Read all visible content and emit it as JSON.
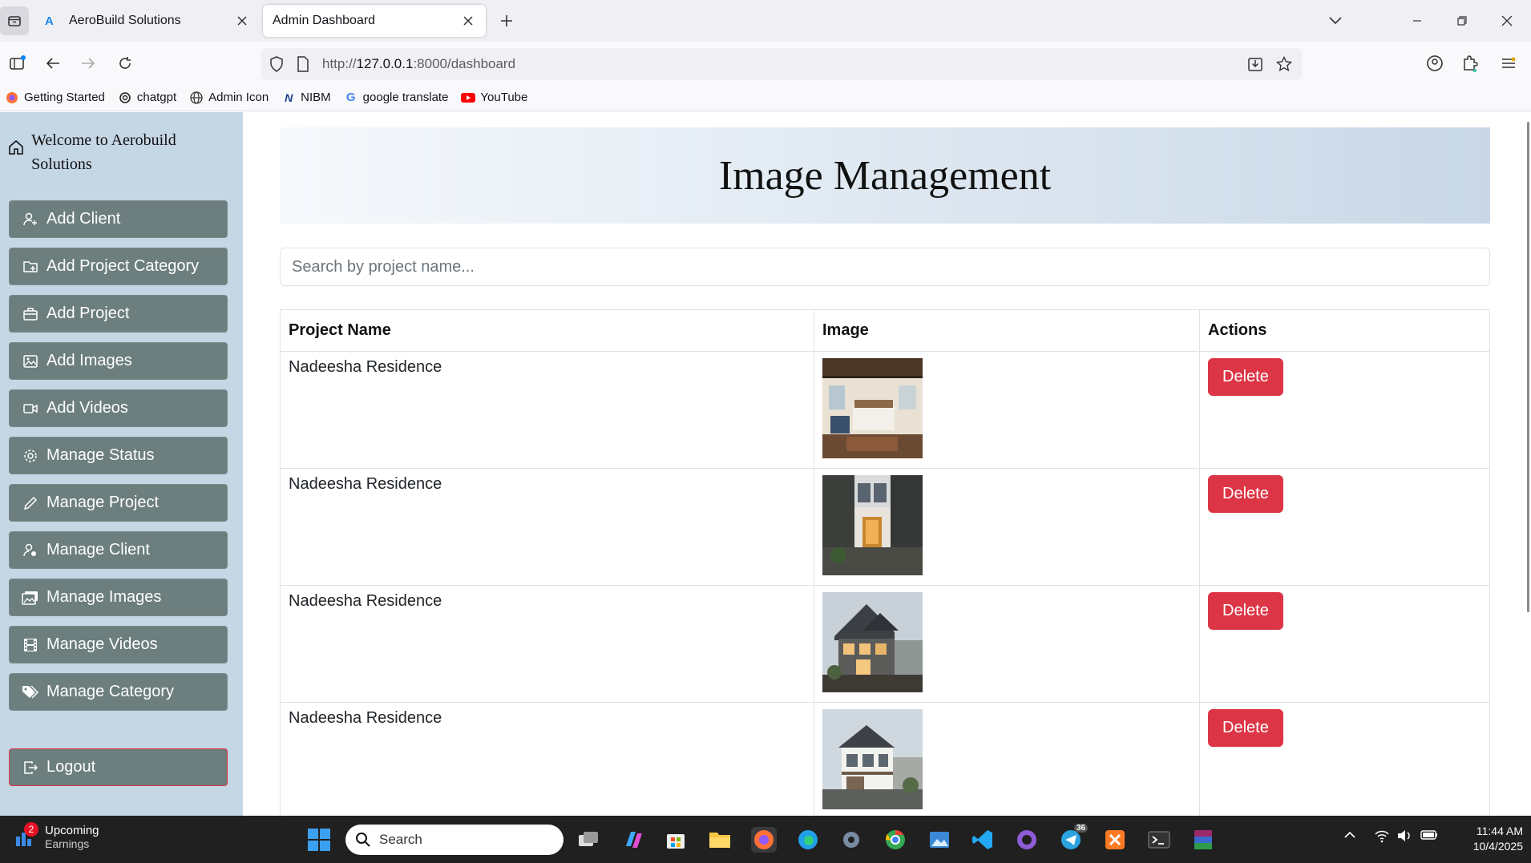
{
  "browser": {
    "tabs": [
      {
        "title": "AeroBuild Solutions",
        "active": false
      },
      {
        "title": "Admin Dashboard",
        "active": true
      }
    ],
    "url_prefix": "http://",
    "url_host": "127.0.0.1",
    "url_path": ":8000/dashboard",
    "bookmarks": [
      {
        "label": "Getting Started",
        "icon": "firefox-icon"
      },
      {
        "label": "chatgpt",
        "icon": "chatgpt-icon"
      },
      {
        "label": "Admin Icon",
        "icon": "globe-icon"
      },
      {
        "label": "NIBM",
        "icon": "nibm-icon"
      },
      {
        "label": "google translate",
        "icon": "google-icon"
      },
      {
        "label": "YouTube",
        "icon": "youtube-icon"
      }
    ]
  },
  "sidebar": {
    "welcome": "Welcome to Aerobuild Solutions",
    "items": [
      {
        "label": "Add Client",
        "icon": "user-plus-icon"
      },
      {
        "label": "Add Project Category",
        "icon": "folder-plus-icon"
      },
      {
        "label": "Add Project",
        "icon": "briefcase-icon"
      },
      {
        "label": "Add Images",
        "icon": "image-icon"
      },
      {
        "label": "Add Videos",
        "icon": "video-icon"
      },
      {
        "label": "Manage Status",
        "icon": "gear-icon"
      },
      {
        "label": "Manage Project",
        "icon": "pencil-icon"
      },
      {
        "label": "Manage Client",
        "icon": "user-gear-icon"
      },
      {
        "label": "Manage Images",
        "icon": "images-icon"
      },
      {
        "label": "Manage Videos",
        "icon": "film-icon"
      },
      {
        "label": "Manage Category",
        "icon": "tags-icon"
      }
    ],
    "logout": "Logout"
  },
  "main": {
    "title": "Image Management",
    "search_placeholder": "Search by project name...",
    "table": {
      "headers": [
        "Project Name",
        "Image",
        "Actions"
      ],
      "rows": [
        {
          "project": "Nadeesha Residence",
          "image": "bedroom interior",
          "action": "Delete"
        },
        {
          "project": "Nadeesha Residence",
          "image": "entrance at night",
          "action": "Delete"
        },
        {
          "project": "Nadeesha Residence",
          "image": "house exterior dusk",
          "action": "Delete"
        },
        {
          "project": "Nadeesha Residence",
          "image": "house exterior day",
          "action": "Delete"
        }
      ]
    }
  },
  "taskbar": {
    "weather_line1": "Upcoming",
    "weather_line2": "Earnings",
    "notification_count": "2",
    "search_label": "Search",
    "telegram_badge": "36",
    "time": "11:44 AM",
    "date": "10/4/2025"
  },
  "colors": {
    "sidebar_bg": "#c5d6e5",
    "sidebar_button": "#6c7e7e",
    "danger": "#dc3545",
    "taskbar": "#202020"
  }
}
